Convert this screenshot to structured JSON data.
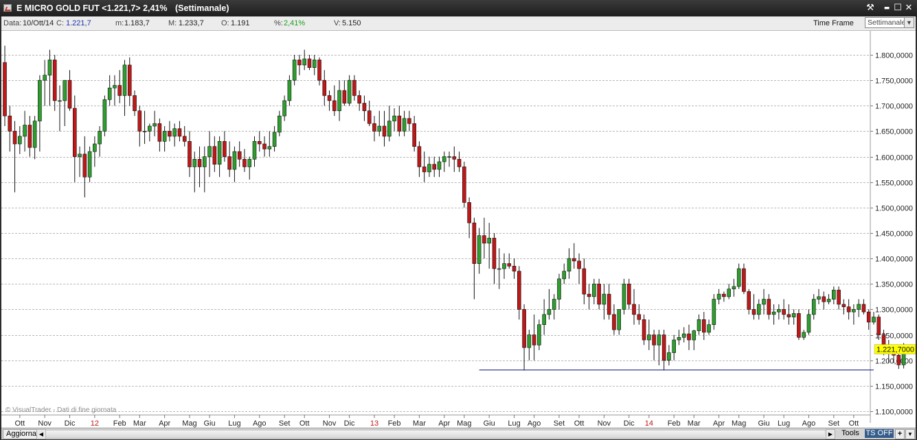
{
  "window": {
    "title": "E MICRO GOLD FUT <1.221,7> 2,41%",
    "period": "(Settimanale)",
    "tools_glyph": "⚒",
    "minimize_glyph": "▬",
    "maximize_glyph": "☐",
    "close_glyph": "✕"
  },
  "infobar": {
    "data_label": "Data:",
    "data_value": "10/Ott/14",
    "c_label": "C:",
    "c_value": "1.221,7",
    "m_label": "m:",
    "m_value": "1.183,7",
    "M_label": "M:",
    "M_value": "1.233,7",
    "o_label": "O:",
    "o_value": "1.191",
    "pct_label": "%:",
    "pct_value": "2,41%",
    "v_label": "V:",
    "v_value": "5.150",
    "timeframe_label": "Time Frame",
    "timeframe_value": "Settimanale",
    "dropdown_glyph": "▼"
  },
  "watermark": "© VisualTrader - Dati di fine giornata",
  "bottombar": {
    "refresh_label": "Aggiorna",
    "tools_label": "Tools",
    "ts_label": "TS OFF",
    "plus_label": "+",
    "down_label": "▼",
    "left_arrow": "◀",
    "right_arrow": "▶"
  },
  "colors": {
    "up": "#2e9e2e",
    "down": "#c01818",
    "grid": "#b8b8b8",
    "support_line": "#1e2a8a",
    "price_tag_bg": "#ffff00",
    "ts_off_bg": "#355d8c"
  },
  "chart_data": {
    "type": "candlestick",
    "instrument": "E MICRO GOLD FUT",
    "timeframe": "Settimanale",
    "last_price_label": "1.221,7000",
    "last_price": 1221.7,
    "ylim": [
      1100000,
      1820000
    ],
    "y_unit_note": "",
    "y_ticks": [
      {
        "v": 1100,
        "label": "1.100,0000"
      },
      {
        "v": 1150,
        "label": "1.150,0000"
      },
      {
        "v": 1200,
        "label": "1.200,0000"
      },
      {
        "v": 1250,
        "label": "1.250,0000"
      },
      {
        "v": 1300,
        "label": "1.300,0000"
      },
      {
        "v": 1350,
        "label": "1.350,0000"
      },
      {
        "v": 1400,
        "label": "1.400,0000"
      },
      {
        "v": 1450,
        "label": "1.450,0000"
      },
      {
        "v": 1500,
        "label": "1.500,0000"
      },
      {
        "v": 1550,
        "label": "1.550,0000"
      },
      {
        "v": 1600,
        "label": "1.600,0000"
      },
      {
        "v": 1650,
        "label": "1.650,0000"
      },
      {
        "v": 1700,
        "label": "1.700,0000"
      },
      {
        "v": 1750,
        "label": "1.750,0000"
      },
      {
        "v": 1800,
        "label": "1.800,0000"
      }
    ],
    "x_ticks": [
      {
        "label": "Ott",
        "bar": 3
      },
      {
        "label": "Nov",
        "bar": 8
      },
      {
        "label": "Dic",
        "bar": 13
      },
      {
        "label": "12",
        "bar": 18,
        "color": "#c01818"
      },
      {
        "label": "Feb",
        "bar": 23
      },
      {
        "label": "Mar",
        "bar": 27
      },
      {
        "label": "Apr",
        "bar": 32
      },
      {
        "label": "Mag",
        "bar": 37
      },
      {
        "label": "Giu",
        "bar": 41
      },
      {
        "label": "Lug",
        "bar": 46
      },
      {
        "label": "Ago",
        "bar": 51
      },
      {
        "label": "Set",
        "bar": 56
      },
      {
        "label": "Ott",
        "bar": 60
      },
      {
        "label": "Nov",
        "bar": 65
      },
      {
        "label": "Dic",
        "bar": 69
      },
      {
        "label": "13",
        "bar": 74,
        "color": "#c01818"
      },
      {
        "label": "Feb",
        "bar": 78
      },
      {
        "label": "Mar",
        "bar": 83
      },
      {
        "label": "Apr",
        "bar": 88
      },
      {
        "label": "Mag",
        "bar": 92
      },
      {
        "label": "Giu",
        "bar": 97
      },
      {
        "label": "Lug",
        "bar": 102
      },
      {
        "label": "Ago",
        "bar": 106
      },
      {
        "label": "Set",
        "bar": 111
      },
      {
        "label": "Ott",
        "bar": 115
      },
      {
        "label": "Nov",
        "bar": 120
      },
      {
        "label": "Dic",
        "bar": 125
      },
      {
        "label": "14",
        "bar": 129,
        "color": "#c01818"
      },
      {
        "label": "Feb",
        "bar": 134
      },
      {
        "label": "Mar",
        "bar": 138
      },
      {
        "label": "Apr",
        "bar": 143
      },
      {
        "label": "Mag",
        "bar": 147
      },
      {
        "label": "Giu",
        "bar": 152
      },
      {
        "label": "Lug",
        "bar": 156
      },
      {
        "label": "Ago",
        "bar": 161
      },
      {
        "label": "Set",
        "bar": 166
      },
      {
        "label": "Ott",
        "bar": 170
      }
    ],
    "support_line": {
      "value": 1181,
      "from_bar": 95,
      "to_bar": 174
    },
    "ohlc": [
      [
        1785,
        1818,
        1660,
        1680
      ],
      [
        1680,
        1700,
        1610,
        1650
      ],
      [
        1650,
        1670,
        1530,
        1625
      ],
      [
        1625,
        1660,
        1605,
        1640
      ],
      [
        1640,
        1690,
        1610,
        1662
      ],
      [
        1662,
        1680,
        1600,
        1618
      ],
      [
        1618,
        1680,
        1595,
        1670
      ],
      [
        1670,
        1760,
        1610,
        1750
      ],
      [
        1750,
        1790,
        1700,
        1760
      ],
      [
        1760,
        1810,
        1700,
        1790
      ],
      [
        1790,
        1800,
        1690,
        1710
      ],
      [
        1710,
        1740,
        1650,
        1710
      ],
      [
        1710,
        1750,
        1660,
        1750
      ],
      [
        1750,
        1770,
        1690,
        1695
      ],
      [
        1695,
        1720,
        1550,
        1600
      ],
      [
        1600,
        1620,
        1560,
        1605
      ],
      [
        1605,
        1640,
        1520,
        1560
      ],
      [
        1560,
        1620,
        1550,
        1610
      ],
      [
        1610,
        1640,
        1580,
        1625
      ],
      [
        1625,
        1660,
        1600,
        1650
      ],
      [
        1650,
        1720,
        1640,
        1712
      ],
      [
        1712,
        1760,
        1700,
        1735
      ],
      [
        1735,
        1760,
        1700,
        1740
      ],
      [
        1740,
        1770,
        1705,
        1720
      ],
      [
        1720,
        1790,
        1680,
        1780
      ],
      [
        1780,
        1795,
        1700,
        1720
      ],
      [
        1720,
        1730,
        1680,
        1690
      ],
      [
        1690,
        1700,
        1620,
        1650
      ],
      [
        1650,
        1690,
        1625,
        1650
      ],
      [
        1650,
        1665,
        1630,
        1660
      ],
      [
        1660,
        1690,
        1640,
        1665
      ],
      [
        1665,
        1675,
        1610,
        1630
      ],
      [
        1630,
        1660,
        1610,
        1650
      ],
      [
        1650,
        1670,
        1630,
        1640
      ],
      [
        1640,
        1665,
        1620,
        1655
      ],
      [
        1655,
        1670,
        1630,
        1640
      ],
      [
        1640,
        1660,
        1620,
        1630
      ],
      [
        1630,
        1650,
        1560,
        1580
      ],
      [
        1580,
        1610,
        1530,
        1595
      ],
      [
        1595,
        1620,
        1540,
        1580
      ],
      [
        1580,
        1620,
        1530,
        1600
      ],
      [
        1600,
        1650,
        1560,
        1620
      ],
      [
        1620,
        1640,
        1570,
        1585
      ],
      [
        1585,
        1640,
        1560,
        1630
      ],
      [
        1630,
        1650,
        1590,
        1600
      ],
      [
        1600,
        1630,
        1560,
        1575
      ],
      [
        1575,
        1620,
        1550,
        1610
      ],
      [
        1610,
        1630,
        1580,
        1595
      ],
      [
        1595,
        1615,
        1570,
        1580
      ],
      [
        1580,
        1600,
        1555,
        1595
      ],
      [
        1595,
        1640,
        1580,
        1630
      ],
      [
        1630,
        1650,
        1610,
        1625
      ],
      [
        1625,
        1640,
        1600,
        1615
      ],
      [
        1615,
        1650,
        1600,
        1620
      ],
      [
        1620,
        1660,
        1610,
        1648
      ],
      [
        1648,
        1690,
        1640,
        1680
      ],
      [
        1680,
        1720,
        1670,
        1710
      ],
      [
        1710,
        1760,
        1700,
        1750
      ],
      [
        1750,
        1800,
        1740,
        1790
      ],
      [
        1790,
        1800,
        1760,
        1780
      ],
      [
        1780,
        1810,
        1770,
        1792
      ],
      [
        1792,
        1800,
        1770,
        1775
      ],
      [
        1775,
        1800,
        1760,
        1790
      ],
      [
        1790,
        1795,
        1740,
        1750
      ],
      [
        1750,
        1770,
        1700,
        1720
      ],
      [
        1720,
        1730,
        1690,
        1710
      ],
      [
        1710,
        1740,
        1680,
        1690
      ],
      [
        1690,
        1750,
        1670,
        1730
      ],
      [
        1730,
        1750,
        1700,
        1705
      ],
      [
        1705,
        1760,
        1700,
        1750
      ],
      [
        1750,
        1760,
        1710,
        1720
      ],
      [
        1720,
        1730,
        1690,
        1705
      ],
      [
        1705,
        1720,
        1670,
        1690
      ],
      [
        1690,
        1710,
        1660,
        1665
      ],
      [
        1665,
        1680,
        1630,
        1650
      ],
      [
        1650,
        1690,
        1640,
        1660
      ],
      [
        1660,
        1690,
        1620,
        1640
      ],
      [
        1640,
        1700,
        1630,
        1670
      ],
      [
        1670,
        1695,
        1650,
        1680
      ],
      [
        1680,
        1700,
        1640,
        1650
      ],
      [
        1650,
        1690,
        1640,
        1675
      ],
      [
        1675,
        1690,
        1650,
        1665
      ],
      [
        1665,
        1680,
        1610,
        1620
      ],
      [
        1620,
        1630,
        1560,
        1580
      ],
      [
        1580,
        1610,
        1550,
        1570
      ],
      [
        1570,
        1600,
        1560,
        1585
      ],
      [
        1585,
        1600,
        1560,
        1575
      ],
      [
        1575,
        1600,
        1560,
        1590
      ],
      [
        1590,
        1610,
        1570,
        1600
      ],
      [
        1600,
        1610,
        1580,
        1600
      ],
      [
        1600,
        1620,
        1570,
        1595
      ],
      [
        1595,
        1610,
        1570,
        1580
      ],
      [
        1580,
        1590,
        1500,
        1510
      ],
      [
        1510,
        1520,
        1440,
        1470
      ],
      [
        1470,
        1480,
        1320,
        1390
      ],
      [
        1390,
        1460,
        1370,
        1445
      ],
      [
        1445,
        1480,
        1400,
        1430
      ],
      [
        1430,
        1470,
        1380,
        1440
      ],
      [
        1440,
        1450,
        1350,
        1380
      ],
      [
        1380,
        1420,
        1340,
        1380
      ],
      [
        1380,
        1410,
        1360,
        1390
      ],
      [
        1390,
        1410,
        1380,
        1385
      ],
      [
        1385,
        1400,
        1360,
        1375
      ],
      [
        1375,
        1385,
        1280,
        1300
      ],
      [
        1300,
        1310,
        1180,
        1225
      ],
      [
        1225,
        1260,
        1200,
        1250
      ],
      [
        1250,
        1290,
        1200,
        1230
      ],
      [
        1230,
        1280,
        1220,
        1270
      ],
      [
        1270,
        1320,
        1250,
        1290
      ],
      [
        1290,
        1340,
        1280,
        1300
      ],
      [
        1300,
        1330,
        1280,
        1320
      ],
      [
        1320,
        1370,
        1300,
        1360
      ],
      [
        1360,
        1390,
        1350,
        1375
      ],
      [
        1375,
        1420,
        1360,
        1400
      ],
      [
        1400,
        1430,
        1380,
        1395
      ],
      [
        1395,
        1410,
        1350,
        1380
      ],
      [
        1380,
        1400,
        1310,
        1330
      ],
      [
        1330,
        1350,
        1300,
        1325
      ],
      [
        1325,
        1360,
        1310,
        1350
      ],
      [
        1350,
        1360,
        1300,
        1310
      ],
      [
        1310,
        1350,
        1280,
        1330
      ],
      [
        1330,
        1350,
        1280,
        1290
      ],
      [
        1290,
        1310,
        1250,
        1260
      ],
      [
        1260,
        1300,
        1250,
        1300
      ],
      [
        1300,
        1360,
        1290,
        1350
      ],
      [
        1350,
        1360,
        1300,
        1310
      ],
      [
        1310,
        1340,
        1270,
        1290
      ],
      [
        1290,
        1310,
        1270,
        1280
      ],
      [
        1280,
        1290,
        1230,
        1240
      ],
      [
        1240,
        1280,
        1220,
        1250
      ],
      [
        1250,
        1260,
        1200,
        1230
      ],
      [
        1230,
        1260,
        1190,
        1250
      ],
      [
        1250,
        1260,
        1180,
        1200
      ],
      [
        1200,
        1230,
        1190,
        1215
      ],
      [
        1215,
        1250,
        1200,
        1240
      ],
      [
        1240,
        1260,
        1230,
        1245
      ],
      [
        1245,
        1265,
        1235,
        1252
      ],
      [
        1252,
        1270,
        1220,
        1240
      ],
      [
        1240,
        1260,
        1220,
        1258
      ],
      [
        1258,
        1290,
        1250,
        1280
      ],
      [
        1280,
        1295,
        1240,
        1255
      ],
      [
        1255,
        1280,
        1250,
        1270
      ],
      [
        1270,
        1330,
        1260,
        1320
      ],
      [
        1320,
        1340,
        1310,
        1330
      ],
      [
        1330,
        1335,
        1315,
        1325
      ],
      [
        1325,
        1350,
        1320,
        1340
      ],
      [
        1340,
        1360,
        1325,
        1345
      ],
      [
        1345,
        1390,
        1340,
        1380
      ],
      [
        1380,
        1390,
        1330,
        1335
      ],
      [
        1335,
        1340,
        1290,
        1300
      ],
      [
        1300,
        1330,
        1280,
        1290
      ],
      [
        1290,
        1320,
        1280,
        1310
      ],
      [
        1310,
        1340,
        1290,
        1320
      ],
      [
        1320,
        1330,
        1280,
        1290
      ],
      [
        1290,
        1310,
        1270,
        1295
      ],
      [
        1295,
        1310,
        1280,
        1300
      ],
      [
        1300,
        1320,
        1280,
        1290
      ],
      [
        1290,
        1310,
        1270,
        1285
      ],
      [
        1285,
        1300,
        1270,
        1292
      ],
      [
        1292,
        1300,
        1240,
        1245
      ],
      [
        1245,
        1260,
        1240,
        1255
      ],
      [
        1255,
        1300,
        1250,
        1290
      ],
      [
        1290,
        1330,
        1280,
        1320
      ],
      [
        1320,
        1340,
        1310,
        1325
      ],
      [
        1325,
        1335,
        1300,
        1315
      ],
      [
        1315,
        1330,
        1310,
        1320
      ],
      [
        1320,
        1345,
        1310,
        1338
      ],
      [
        1338,
        1345,
        1300,
        1310
      ],
      [
        1310,
        1320,
        1290,
        1305
      ],
      [
        1305,
        1320,
        1280,
        1295
      ],
      [
        1295,
        1310,
        1270,
        1300
      ],
      [
        1300,
        1320,
        1285,
        1310
      ],
      [
        1310,
        1320,
        1290,
        1295
      ],
      [
        1295,
        1300,
        1260,
        1275
      ],
      [
        1275,
        1295,
        1270,
        1285
      ],
      [
        1285,
        1290,
        1240,
        1250
      ],
      [
        1250,
        1260,
        1210,
        1225
      ],
      [
        1225,
        1240,
        1195,
        1215
      ],
      [
        1215,
        1230,
        1195,
        1210
      ],
      [
        1210,
        1230,
        1183,
        1191
      ],
      [
        1191,
        1234,
        1184,
        1222
      ]
    ]
  }
}
